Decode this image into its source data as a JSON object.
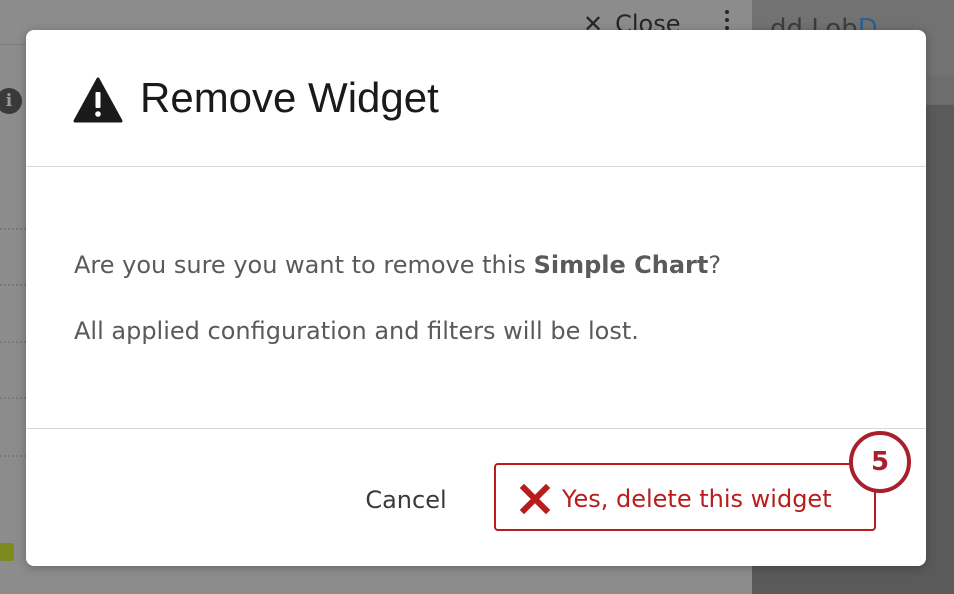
{
  "background": {
    "close_label": "Close",
    "close_symbol": "✕",
    "right_panel_text": "dd Lob",
    "right_panel_accent": "D",
    "info_symbol": "i"
  },
  "modal": {
    "title": "Remove Widget",
    "title_icon": "warning-icon",
    "body": {
      "line1_prefix": "Are you sure you want to remove this ",
      "line1_bold": "Simple Chart",
      "line1_suffix": "?",
      "line2": "All applied configuration and filters will be lost."
    },
    "footer": {
      "cancel_label": "Cancel",
      "delete_label": "Yes, delete this widget",
      "delete_icon": "x-icon"
    },
    "step_badge": "5"
  },
  "colors": {
    "danger": "#b81d1d",
    "badge": "#a8202b",
    "overlay": "#8c8c8c"
  }
}
